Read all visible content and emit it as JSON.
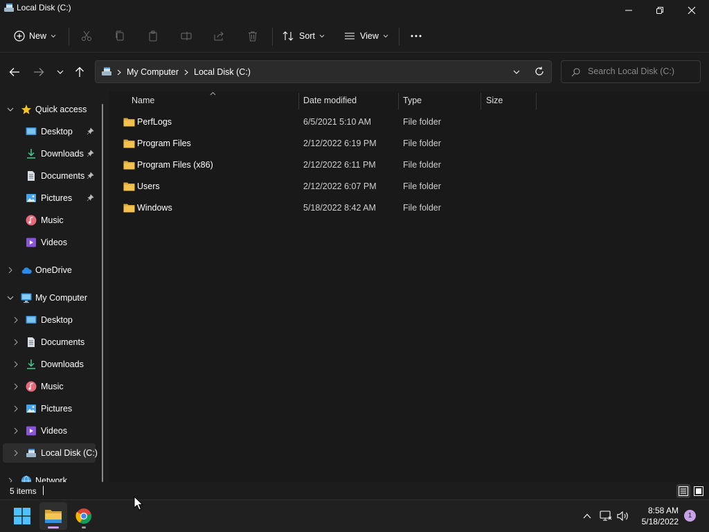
{
  "window": {
    "title": "Local Disk (C:)"
  },
  "toolbar": {
    "new_label": "New",
    "sort_label": "Sort",
    "view_label": "View"
  },
  "address": {
    "crumbs": [
      "My Computer",
      "Local Disk (C:)"
    ]
  },
  "search": {
    "placeholder": "Search Local Disk (C:)"
  },
  "sidebar": {
    "quick_access": "Quick access",
    "quick_items": [
      {
        "label": "Desktop",
        "icon": "desktop-icon",
        "pinned": true
      },
      {
        "label": "Downloads",
        "icon": "download-icon",
        "pinned": true
      },
      {
        "label": "Documents",
        "icon": "document-icon",
        "pinned": true
      },
      {
        "label": "Pictures",
        "icon": "pictures-icon",
        "pinned": true
      },
      {
        "label": "Music",
        "icon": "music-icon",
        "pinned": false
      },
      {
        "label": "Videos",
        "icon": "videos-icon",
        "pinned": false
      }
    ],
    "onedrive": "OneDrive",
    "my_computer": "My Computer",
    "computer_items": [
      {
        "label": "Desktop",
        "icon": "desktop-icon"
      },
      {
        "label": "Documents",
        "icon": "document-icon"
      },
      {
        "label": "Downloads",
        "icon": "download-icon"
      },
      {
        "label": "Music",
        "icon": "music-icon"
      },
      {
        "label": "Pictures",
        "icon": "pictures-icon"
      },
      {
        "label": "Videos",
        "icon": "videos-icon"
      },
      {
        "label": "Local Disk (C:)",
        "icon": "drive-icon"
      }
    ],
    "network": "Network"
  },
  "columns": {
    "name": "Name",
    "date": "Date modified",
    "type": "Type",
    "size": "Size"
  },
  "files": [
    {
      "name": "PerfLogs",
      "date": "6/5/2021 5:10 AM",
      "type": "File folder"
    },
    {
      "name": "Program Files",
      "date": "2/12/2022 6:19 PM",
      "type": "File folder"
    },
    {
      "name": "Program Files (x86)",
      "date": "2/12/2022 6:11 PM",
      "type": "File folder"
    },
    {
      "name": "Users",
      "date": "2/12/2022 6:07 PM",
      "type": "File folder"
    },
    {
      "name": "Windows",
      "date": "5/18/2022 8:42 AM",
      "type": "File folder"
    }
  ],
  "status": {
    "item_count": "5 items"
  },
  "taskbar": {
    "time": "8:58 AM",
    "date": "5/18/2022",
    "notifications": "1"
  },
  "colors": {
    "folder": "#f2c14e",
    "accent": "#4cc2ff",
    "background": "#1c1c1c"
  }
}
